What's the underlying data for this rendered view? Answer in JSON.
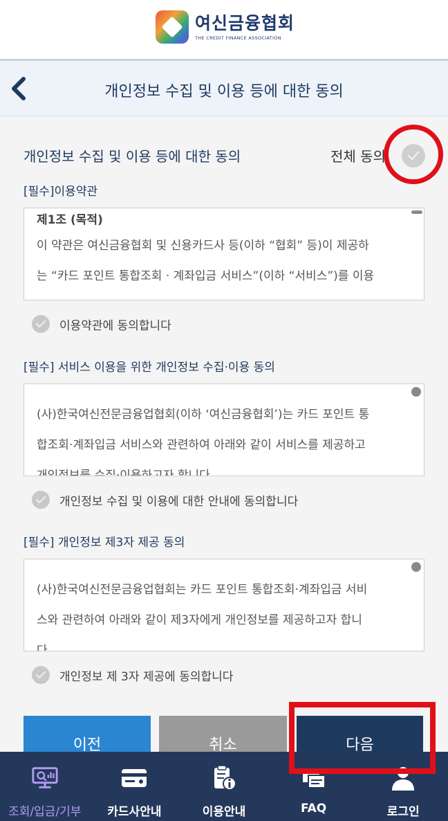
{
  "header": {
    "logo_name": "여신금융협회",
    "logo_sub": "THE CREDIT FINANCE ASSOCIATION"
  },
  "title_bar": {
    "title": "개인정보 수집 및 이용 등에 대한 동의"
  },
  "consent": {
    "heading": "개인정보 수집 및 이용 등에 대한 동의",
    "all_agree_label": "전체 동의",
    "sections": [
      {
        "title": "[필수]이용약관",
        "heading": "제1조 (목적)",
        "lines": [
          "이 약관은 여신금융협회 및 신용카드사 등(이하 “협회” 등)이 제공하",
          "는 “카드 포인트 통합조회 · 계좌입금 서비스”(이하 “서비스”)를 이용"
        ],
        "agree_label": "이용약관에 동의합니다"
      },
      {
        "title": "[필수] 서비스 이용을 위한 개인정보 수집·이용 동의",
        "lines": [
          "(사)한국여신전문금융업협회(이하 ‘여신금융협회’)는 카드 포인트 통",
          "합조회·계좌입금 서비스와 관련하여 아래와 같이 서비스를 제공하고",
          "개인정보를 수집·이용하고자 합니다"
        ],
        "agree_label": "개인정보 수집 및 이용에 대한 안내에 동의합니다"
      },
      {
        "title": "[필수] 개인정보 제3자 제공 동의",
        "lines": [
          "(사)한국여신전문금융업협회는 카드 포인트 통합조회·계좌입금 서비",
          "스와 관련하여 아래와 같이 제3자에게 개인정보를 제공하고자 합니",
          "다."
        ],
        "agree_label": "개인정보 제 3자 제공에 동의합니다"
      }
    ]
  },
  "buttons": {
    "prev": "이전",
    "cancel": "취소",
    "next": "다음"
  },
  "nav": {
    "items": [
      {
        "label": "조회/입금/기부",
        "icon": "inquiry-monitor-icon"
      },
      {
        "label": "카드사안내",
        "icon": "credit-card-icon"
      },
      {
        "label": "이용안내",
        "icon": "clipboard-info-icon"
      },
      {
        "label": "FAQ",
        "icon": "faq-icon"
      },
      {
        "label": "로그인",
        "icon": "user-icon"
      }
    ]
  },
  "colors": {
    "brand_navy": "#1f3a5f",
    "prev_blue": "#2b86d1",
    "cancel_gray": "#9a9a9a",
    "highlight_red": "#e0101a",
    "nav_bg": "#24385c",
    "active_nav": "#b49cf0"
  }
}
